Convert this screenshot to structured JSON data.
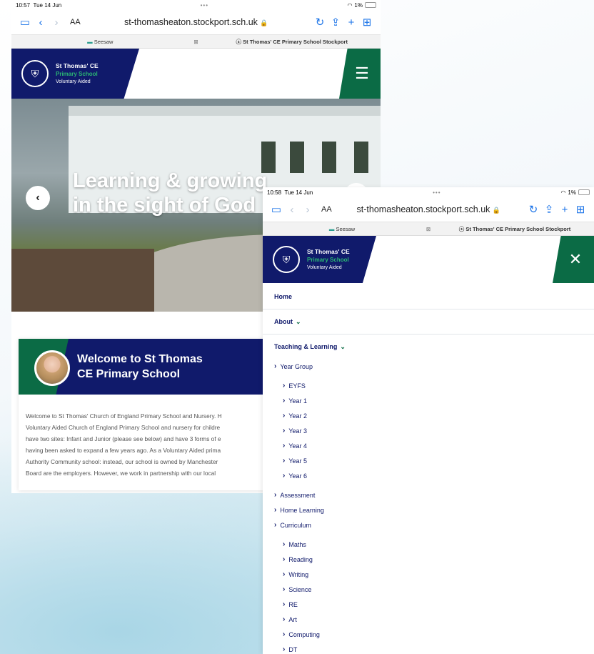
{
  "shot1": {
    "status": {
      "time": "10:57",
      "date": "Tue 14 Jun",
      "battery": "1%"
    },
    "toolbar": {
      "aa": "AA",
      "url": "st-thomasheaton.stockport.sch.uk"
    },
    "tabs": {
      "tab1": "Seesaw",
      "tab2": "St Thomas' CE Primary School Stockport"
    },
    "brand": {
      "line1": "St Thomas' CE",
      "line2": "Primary School",
      "line3": "Voluntary Aided"
    },
    "hero": {
      "title_line1": "Learning & growing",
      "title_line2": "in the sight of God"
    },
    "welcome": {
      "title_line1": "Welcome to St Thomas",
      "title_line2": "CE Primary School",
      "body": [
        "Welcome to St Thomas' Church of England Primary School and Nursery. H",
        "Voluntary Aided Church of England Primary School and nursery for childre",
        "have two sites: Infant and Junior (please see below) and have 3 forms of e",
        "having been asked to expand a few years ago.  As a Voluntary Aided prima",
        "Authority Community school: instead, our school is owned by Manchester",
        "Board are the employers.  However, we work in partnership with our local"
      ]
    }
  },
  "shot2": {
    "status": {
      "time": "10:58",
      "date": "Tue 14 Jun",
      "battery": "1%"
    },
    "toolbar": {
      "aa": "AA",
      "url": "st-thomasheaton.stockport.sch.uk"
    },
    "tabs": {
      "tab1": "Seesaw",
      "tab2": "St Thomas' CE Primary School Stockport"
    },
    "brand": {
      "line1": "St Thomas' CE",
      "line2": "Primary School",
      "line3": "Voluntary Aided"
    },
    "nav": {
      "home": "Home",
      "about": "About",
      "teaching": "Teaching & Learning",
      "year_group": "Year Group",
      "years": [
        "EYFS",
        "Year 1",
        "Year 2",
        "Year 3",
        "Year 4",
        "Year 5",
        "Year 6"
      ],
      "assessment": "Assessment",
      "home_learning": "Home Learning",
      "curriculum": "Curriculum",
      "subjects": [
        "Maths",
        "Reading",
        "Writing",
        "Science",
        "RE",
        "Art",
        "Computing",
        "DT"
      ]
    }
  }
}
